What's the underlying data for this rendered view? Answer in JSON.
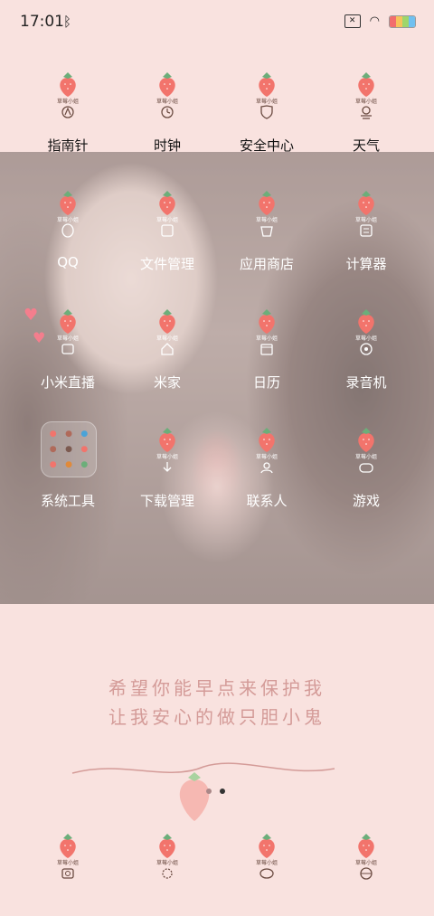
{
  "status_bar": {
    "time": "17:01",
    "bluetooth_icon": "bluetooth-icon",
    "sim_icon": "sim-off-icon",
    "wifi_icon": "wifi-icon",
    "battery_icon": "battery-icon"
  },
  "apps_row1": [
    {
      "label": "指南针",
      "icon": "compass-icon"
    },
    {
      "label": "时钟",
      "icon": "clock-icon"
    },
    {
      "label": "安全中心",
      "icon": "security-icon"
    },
    {
      "label": "天气",
      "icon": "weather-icon"
    }
  ],
  "apps_row2": [
    {
      "label": "QQ",
      "icon": "qq-icon"
    },
    {
      "label": "文件管理",
      "icon": "files-icon"
    },
    {
      "label": "应用商店",
      "icon": "store-icon"
    },
    {
      "label": "计算器",
      "icon": "calculator-icon"
    }
  ],
  "apps_row3": [
    {
      "label": "小米直播",
      "icon": "live-icon"
    },
    {
      "label": "米家",
      "icon": "home-icon"
    },
    {
      "label": "日历",
      "icon": "calendar-icon"
    },
    {
      "label": "录音机",
      "icon": "recorder-icon"
    }
  ],
  "apps_row4": [
    {
      "label": "系统工具",
      "icon": "folder-icon"
    },
    {
      "label": "下载管理",
      "icon": "download-icon"
    },
    {
      "label": "联系人",
      "icon": "contacts-icon"
    },
    {
      "label": "游戏",
      "icon": "games-icon"
    }
  ],
  "icon_tag": "草莓小姐",
  "wallpaper_quote": {
    "line1": "希望你能早点来保护我",
    "line2": "让我安心的做只胆小鬼"
  },
  "dock": [
    {
      "icon": "camera-icon"
    },
    {
      "icon": "settings-icon"
    },
    {
      "icon": "messages-icon"
    },
    {
      "icon": "browser-icon"
    }
  ],
  "colors": {
    "background": "#f9e2df",
    "strawberry": "#f2746c",
    "leaf": "#6cae7a",
    "ink": "#6a4a40",
    "quote": "#d49b98"
  }
}
